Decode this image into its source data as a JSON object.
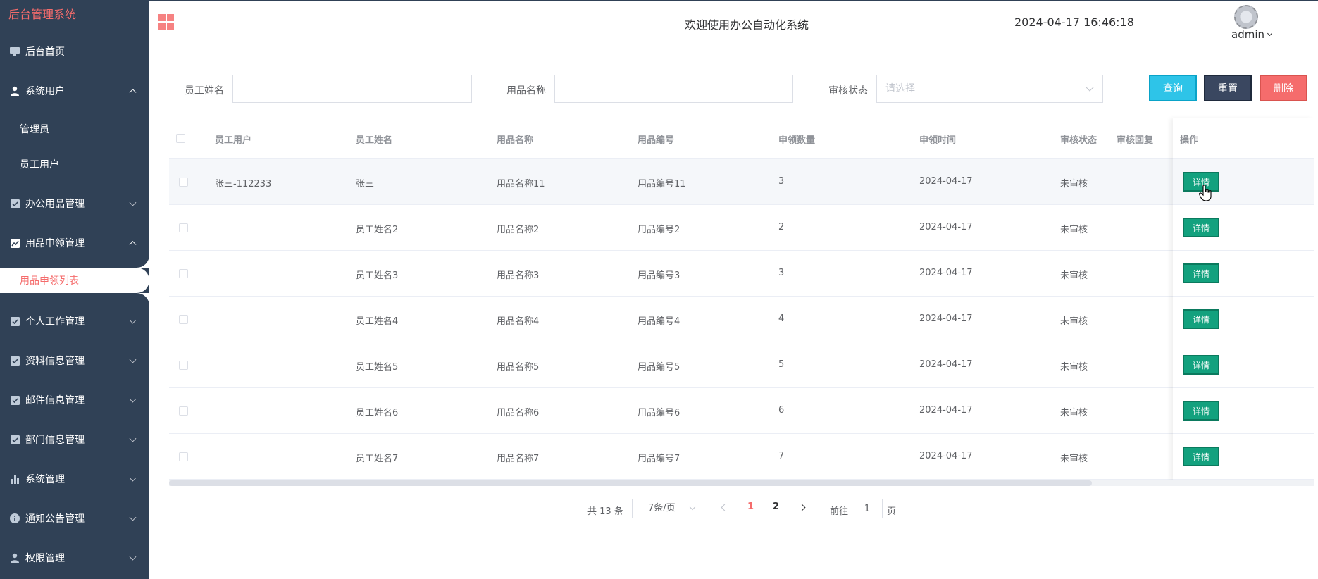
{
  "brand": "后台管理系统",
  "header": {
    "welcome": "欢迎使用办公自动化系统",
    "datetime": "2024-04-17 16:46:18",
    "user": "admin"
  },
  "sidebar": {
    "items": [
      {
        "label": "后台首页",
        "icon": "monitor-icon"
      },
      {
        "label": "系统用户",
        "icon": "user-icon",
        "expanded": true
      },
      {
        "label": "管理员"
      },
      {
        "label": "员工用户"
      },
      {
        "label": "办公用品管理",
        "icon": "check-square-icon"
      },
      {
        "label": "用品申领管理",
        "icon": "chart-line-icon",
        "expanded": true
      },
      {
        "label": "用品申领列表",
        "active": true
      },
      {
        "label": "个人工作管理",
        "icon": "check-square-icon"
      },
      {
        "label": "资料信息管理",
        "icon": "check-square-icon"
      },
      {
        "label": "邮件信息管理",
        "icon": "check-square-icon"
      },
      {
        "label": "部门信息管理",
        "icon": "check-square-icon"
      },
      {
        "label": "系统管理",
        "icon": "bar-chart-icon"
      },
      {
        "label": "通知公告管理",
        "icon": "info-icon"
      },
      {
        "label": "权限管理",
        "icon": "user-icon"
      }
    ]
  },
  "filters": {
    "employee_name_label": "员工姓名",
    "employee_name_value": "",
    "item_name_label": "用品名称",
    "item_name_value": "",
    "status_label": "审核状态",
    "status_placeholder": "请选择",
    "query": "查询",
    "reset": "重置",
    "delete": "删除"
  },
  "table": {
    "columns": [
      "员工用户",
      "员工姓名",
      "用品名称",
      "用品编号",
      "申领数量",
      "申领时间",
      "审核状态",
      "审核回复",
      "操作"
    ],
    "rows": [
      {
        "user": "张三-112233",
        "name": "张三",
        "item": "用品名称11",
        "code": "用品编号11",
        "qty": "3",
        "date": "2024-04-17",
        "status": "未审核",
        "reply": "",
        "action": "详情"
      },
      {
        "user": "",
        "name": "员工姓名2",
        "item": "用品名称2",
        "code": "用品编号2",
        "qty": "2",
        "date": "2024-04-17",
        "status": "未审核",
        "reply": "",
        "action": "详情"
      },
      {
        "user": "",
        "name": "员工姓名3",
        "item": "用品名称3",
        "code": "用品编号3",
        "qty": "3",
        "date": "2024-04-17",
        "status": "未审核",
        "reply": "",
        "action": "详情"
      },
      {
        "user": "",
        "name": "员工姓名4",
        "item": "用品名称4",
        "code": "用品编号4",
        "qty": "4",
        "date": "2024-04-17",
        "status": "未审核",
        "reply": "",
        "action": "详情"
      },
      {
        "user": "",
        "name": "员工姓名5",
        "item": "用品名称5",
        "code": "用品编号5",
        "qty": "5",
        "date": "2024-04-17",
        "status": "未审核",
        "reply": "",
        "action": "详情"
      },
      {
        "user": "",
        "name": "员工姓名6",
        "item": "用品名称6",
        "code": "用品编号6",
        "qty": "6",
        "date": "2024-04-17",
        "status": "未审核",
        "reply": "",
        "action": "详情"
      },
      {
        "user": "",
        "name": "员工姓名7",
        "item": "用品名称7",
        "code": "用品编号7",
        "qty": "7",
        "date": "2024-04-17",
        "status": "未审核",
        "reply": "",
        "action": "详情"
      }
    ]
  },
  "pagination": {
    "total": "共 13 条",
    "page_size": "7条/页",
    "pages": [
      "1",
      "2"
    ],
    "current": "1",
    "goto_label": "前往",
    "goto_value": "1",
    "goto_suffix": "页"
  },
  "colors": {
    "sidebar_bg": "#304156",
    "accent": "#f56c6c",
    "query": "#2ec4e8",
    "reset": "#3a4760",
    "delete": "#f56c6c",
    "detail": "#13a17e"
  }
}
